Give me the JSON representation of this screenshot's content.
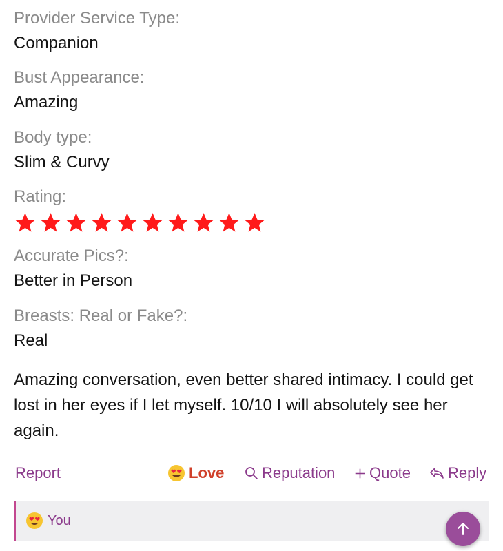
{
  "fields": [
    {
      "label": "Provider Service Type:",
      "value": "Companion"
    },
    {
      "label": "Bust Appearance:",
      "value": "Amazing"
    },
    {
      "label": "Body type:",
      "value": "Slim & Curvy"
    }
  ],
  "rating": {
    "label": "Rating:",
    "stars": 10,
    "max": 10,
    "color": "#ff1a1a"
  },
  "fields2": [
    {
      "label": "Accurate Pics?:",
      "value": "Better in Person"
    },
    {
      "label": "Breasts: Real or Fake?:",
      "value": "Real"
    }
  ],
  "post": {
    "body": "Amazing conversation, even better shared intimacy. I could get lost in her eyes if I let myself. 10/10 I will absolutely see her again."
  },
  "actions": {
    "report": "Report",
    "love": "Love",
    "reputation": "Reputation",
    "quote": "Quote",
    "reply": "Reply"
  },
  "reactions": {
    "reactor": "You",
    "emoji": "heart-eyes-emoji"
  },
  "colors": {
    "accent": "#8b3a8b",
    "love": "#d0402a",
    "star": "#ff1a1a",
    "scroll_button": "#9a4d9a"
  }
}
